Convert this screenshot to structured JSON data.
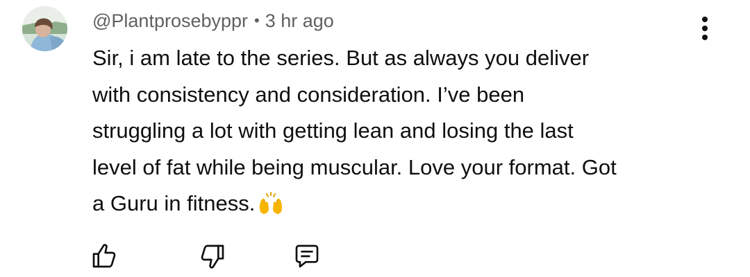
{
  "comment": {
    "author": "@Plantprosebyppr",
    "separator": "•",
    "timestamp": "3 hr ago",
    "text_lines": [
      "Sir, i am late to the series. But as always you deliver",
      "with consistency and consideration. I’ve been",
      "struggling a lot with getting lean and losing the last",
      "level of fat while being muscular. Love your format. Got",
      "a Guru in fitness."
    ],
    "emoji": "raising-hands-emoji"
  },
  "icons": {
    "menu": "more-vert-icon",
    "like": "thumbs-up-icon",
    "dislike": "thumbs-down-icon",
    "reply": "reply-comment-icon"
  },
  "colors": {
    "text": "#0f0f0f",
    "meta": "#606060",
    "emoji": "#f7b500"
  }
}
